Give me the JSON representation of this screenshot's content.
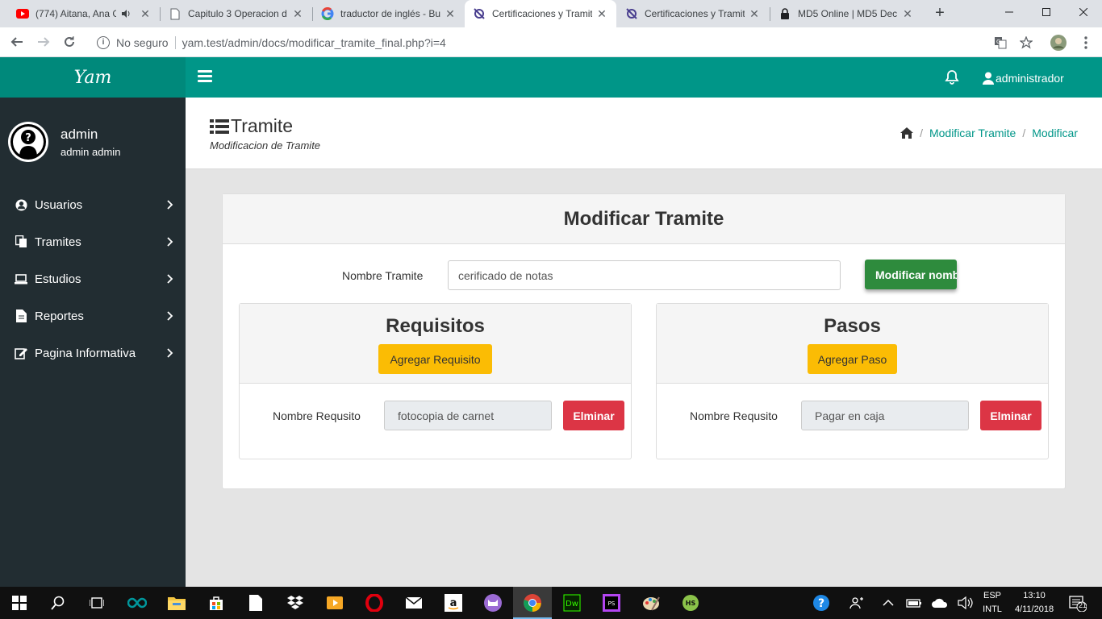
{
  "browser": {
    "tabs": [
      {
        "title": "(774) Aitana, Ana G",
        "icon": "youtube-icon"
      },
      {
        "title": "Capitulo 3 Operacion d",
        "icon": "document-icon"
      },
      {
        "title": "traductor de inglés - Bu",
        "icon": "google-icon"
      },
      {
        "title": "Certificaciones y Tramit",
        "icon": "site-icon"
      },
      {
        "title": "Certificaciones y Tramit",
        "icon": "site-icon"
      },
      {
        "title": "MD5 Online | MD5 Dec",
        "icon": "lock-icon"
      }
    ],
    "new_tab": "+",
    "security_label": "No seguro",
    "url": "yam.test/admin/docs/modificar_tramite_final.php?i=4"
  },
  "header": {
    "brand": "Yam",
    "user_label": "administrador"
  },
  "sidebar": {
    "profile_name": "admin",
    "profile_sub": "admin admin",
    "items": [
      {
        "label": "Usuarios",
        "icon": "user-circle-icon"
      },
      {
        "label": "Tramites",
        "icon": "copy-icon"
      },
      {
        "label": "Estudios",
        "icon": "laptop-icon"
      },
      {
        "label": "Reportes",
        "icon": "file-icon"
      },
      {
        "label": "Pagina Informativa",
        "icon": "edit-icon"
      }
    ]
  },
  "page": {
    "title": "Tramite",
    "subtitle": "Modificacion de Tramite",
    "breadcrumb": [
      "Modificar Tramite",
      "Modificar"
    ]
  },
  "form": {
    "card_title": "Modificar Tramite",
    "name_label": "Nombre Tramite",
    "name_value": "cerificado de notas",
    "modify_button": "Modificar nombre"
  },
  "requisitos": {
    "title": "Requisitos",
    "add_button": "Agregar Requisito",
    "row_label": "Nombre Requsito",
    "row_value": "fotocopia de carnet",
    "delete_button": "Elminar"
  },
  "pasos": {
    "title": "Pasos",
    "add_button": "Agregar Paso",
    "row_label": "Nombre Requsito",
    "row_value": "Pagar en caja",
    "delete_button": "Elminar"
  },
  "taskbar": {
    "language": "ESP",
    "layout": "INTL",
    "time": "13:10",
    "date": "4/11/2018",
    "notifications": "21"
  },
  "colors": {
    "header": "#009688",
    "sidebar": "#222d32",
    "link": "#009688",
    "success": "#2e8b3d",
    "warning": "#fbbc04",
    "danger": "#dc3545"
  }
}
